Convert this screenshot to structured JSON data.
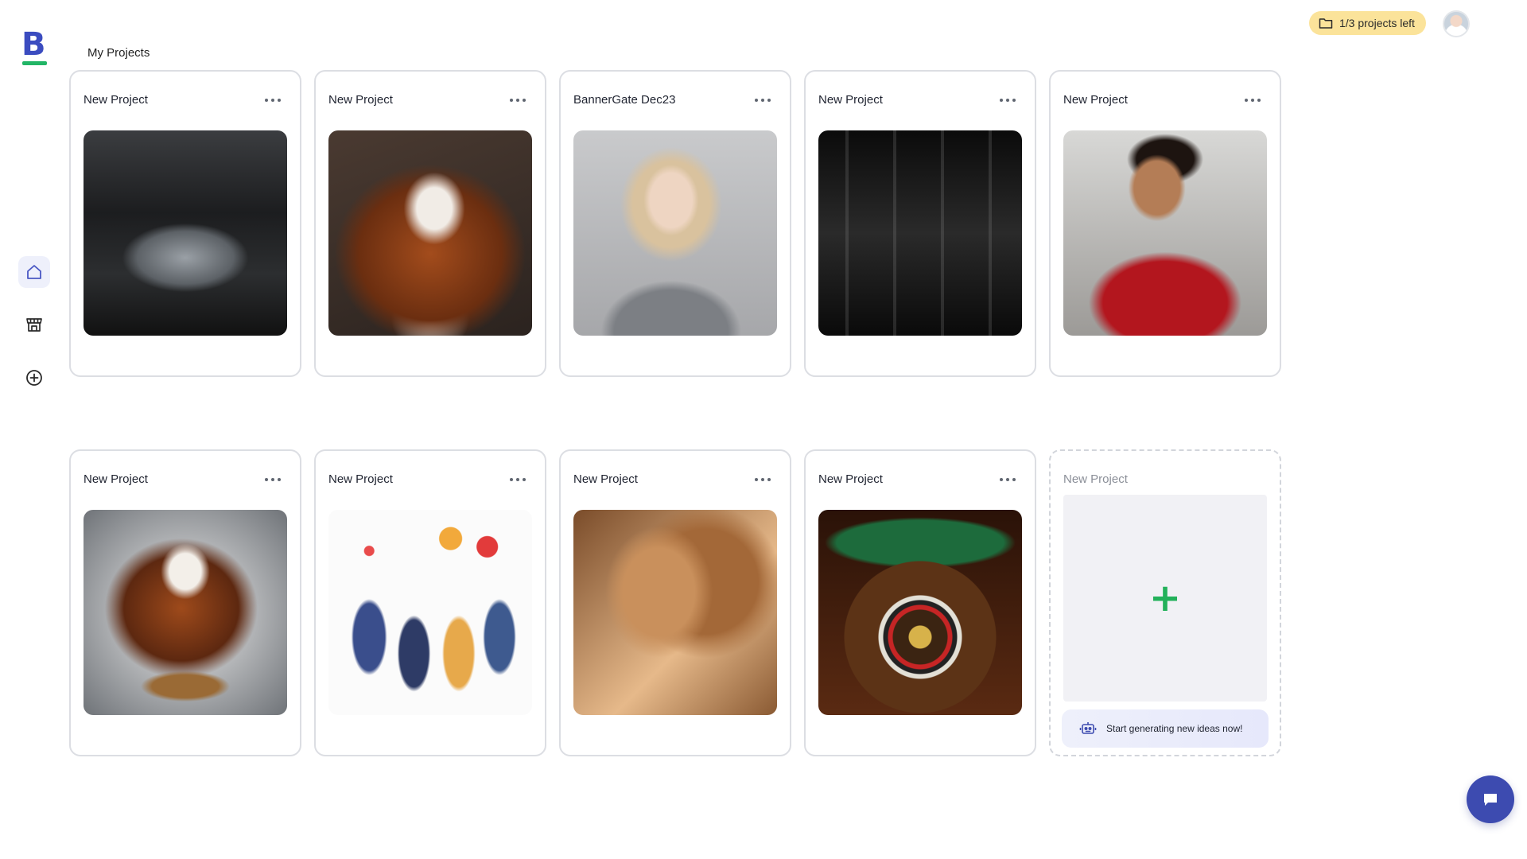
{
  "sidebar": {
    "logo_letter": "B",
    "items": [
      {
        "name": "home",
        "active": true
      },
      {
        "name": "store",
        "active": false
      },
      {
        "name": "create",
        "active": false
      }
    ]
  },
  "topbar": {
    "quota_label": "1/3 projects left"
  },
  "page": {
    "title": "My Projects"
  },
  "projects": [
    {
      "title": "New Project",
      "image": "silver car in garage"
    },
    {
      "title": "New Project",
      "image": "cavalier spaniel portrait"
    },
    {
      "title": "BannerGate Dec23",
      "image": "woman holding phone"
    },
    {
      "title": "New Project",
      "image": "laboratory glassware"
    },
    {
      "title": "New Project",
      "image": "child in red shirt"
    },
    {
      "title": "New Project",
      "image": "spaniel with food bowl"
    },
    {
      "title": "New Project",
      "image": "office party illustration"
    },
    {
      "title": "New Project",
      "image": "woman in sunlight"
    },
    {
      "title": "New Project",
      "image": "roulette wheel"
    }
  ],
  "new_project": {
    "title": "New Project",
    "cta_label": "Start generating new ideas now!"
  },
  "colors": {
    "brand_blue": "#3b4cc0",
    "brand_green": "#22b566",
    "quota_bg": "#fbe39a",
    "chat_bg": "#3d4bb0"
  }
}
